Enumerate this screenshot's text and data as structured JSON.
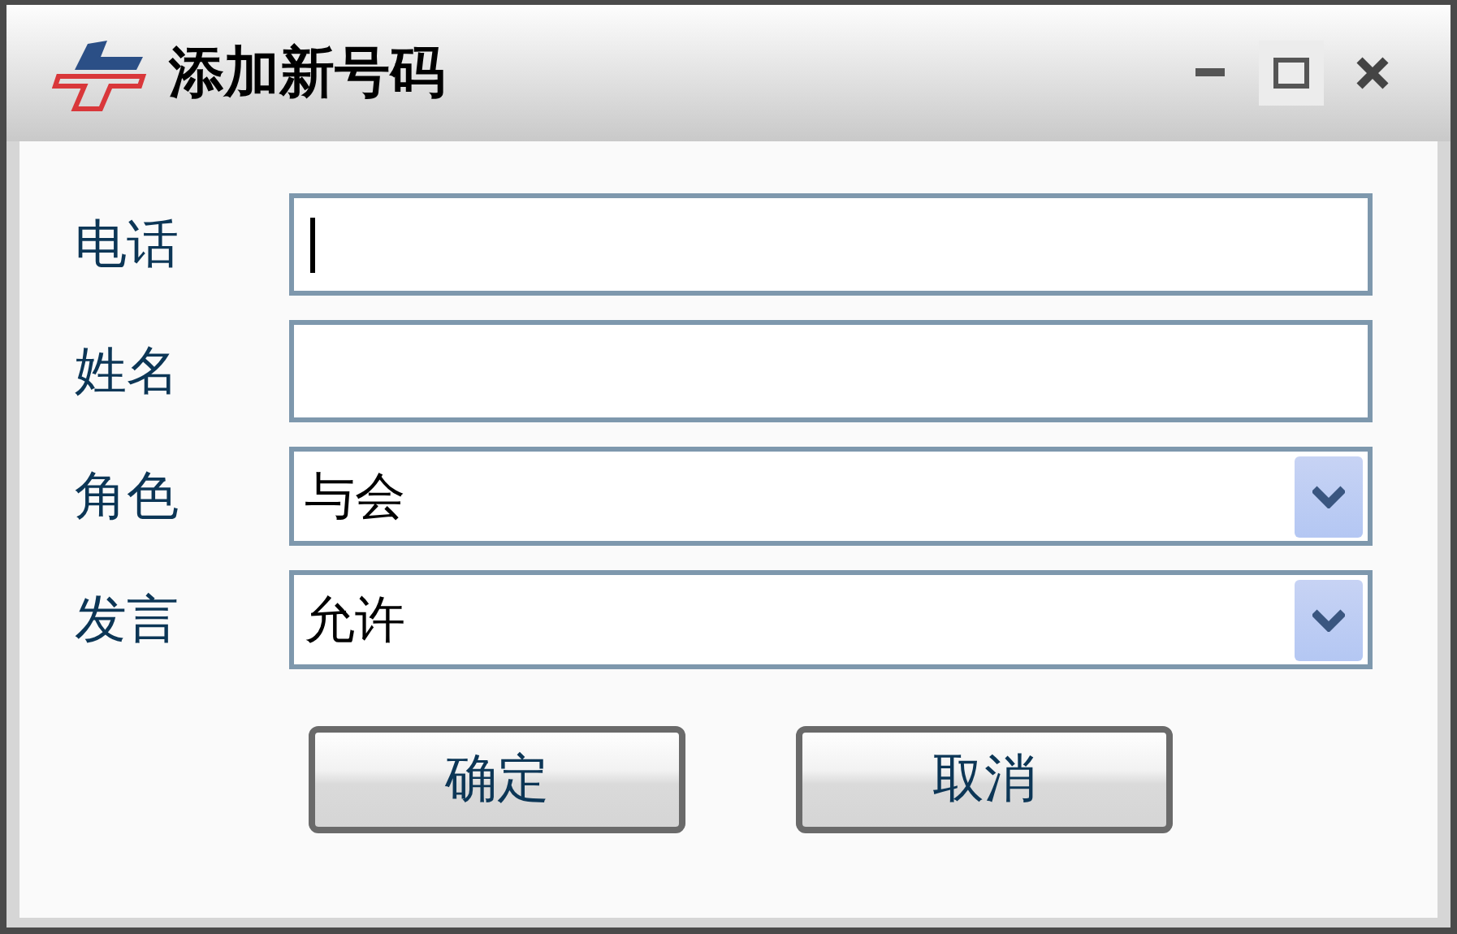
{
  "window": {
    "title": "添加新号码"
  },
  "fields": [
    {
      "label": "电话",
      "kind": "text",
      "focused": true
    },
    {
      "label": "姓名",
      "kind": "text",
      "focused": false
    },
    {
      "label": "角色",
      "kind": "select",
      "value": "与会"
    },
    {
      "label": "发言",
      "kind": "select",
      "value": "允许"
    }
  ],
  "buttons": [
    "确定",
    "取消"
  ]
}
